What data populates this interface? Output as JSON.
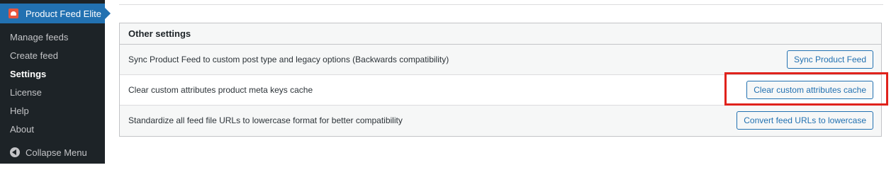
{
  "sidebar": {
    "plugin_title": "Product Feed Elite",
    "items": [
      {
        "label": "Manage feeds"
      },
      {
        "label": "Create feed"
      },
      {
        "label": "Settings"
      },
      {
        "label": "License"
      },
      {
        "label": "Help"
      },
      {
        "label": "About"
      }
    ],
    "current_item": "Settings",
    "collapse_label": "Collapse Menu"
  },
  "other_settings": {
    "header": "Other settings",
    "rows": [
      {
        "description": "Sync Product Feed to custom post type and legacy options (Backwards compatibility)",
        "button": "Sync Product Feed"
      },
      {
        "description": "Clear custom attributes product meta keys cache",
        "button": "Clear custom attributes cache"
      },
      {
        "description": "Standardize all feed file URLs to lowercase format for better compatibility",
        "button": "Convert feed URLs to lowercase"
      }
    ]
  },
  "colors": {
    "sidebar_bg": "#1d2327",
    "accent": "#2271b1",
    "highlight": "#e0221c"
  }
}
